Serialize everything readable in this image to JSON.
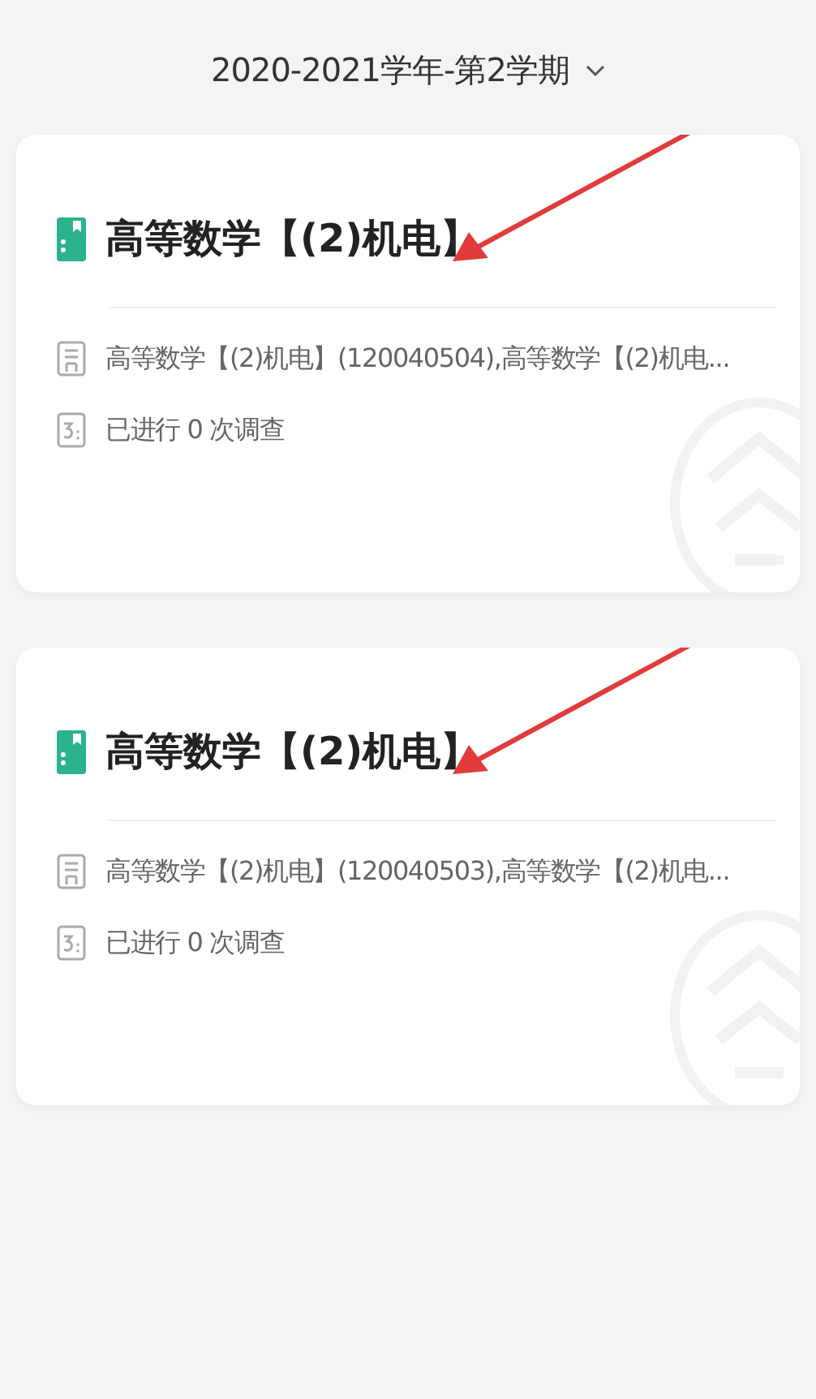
{
  "semester_picker": {
    "label": "2020-2021学年-第2学期",
    "expanded": false
  },
  "courses": [
    {
      "title": "高等数学【(2)机电】",
      "classes": "高等数学【(2)机电】(120040504),高等数学【(2)机电...",
      "surveys": "已进行 0 次调查",
      "annotated": true
    },
    {
      "title": "高等数学【(2)机电】",
      "classes": "高等数学【(2)机电】(120040503),高等数学【(2)机电...",
      "surveys": "已进行 0 次调查",
      "annotated": true
    }
  ]
}
